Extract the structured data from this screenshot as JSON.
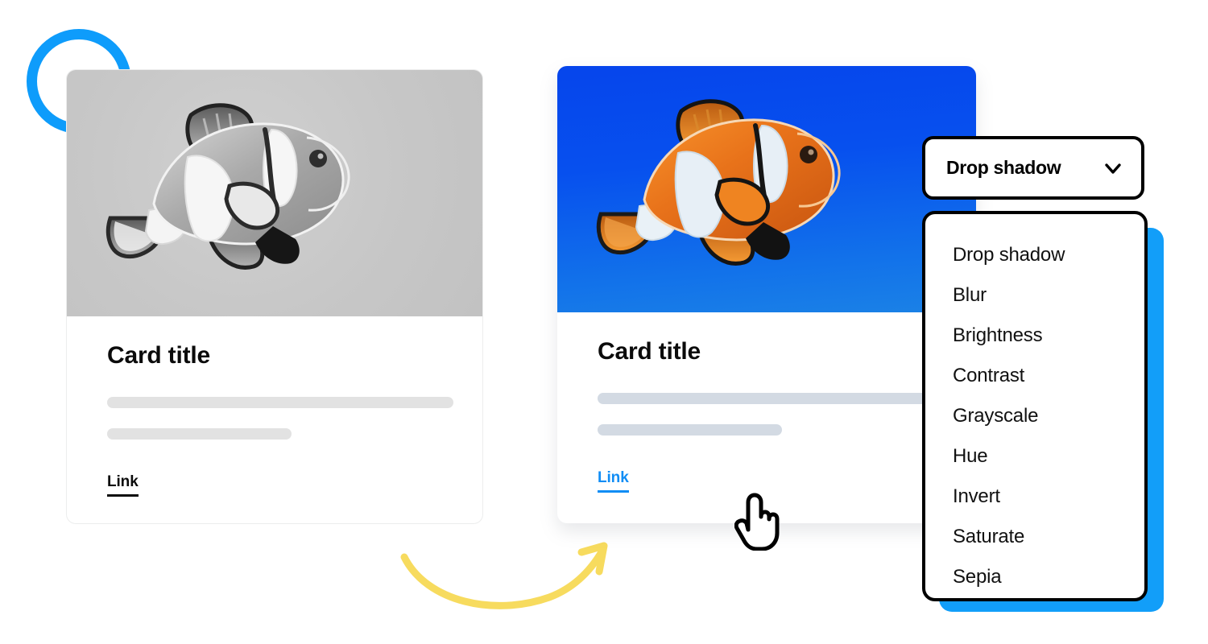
{
  "decor": {
    "ring": {
      "name": "blue-ring",
      "color": "#0e9cfb"
    },
    "arrow": {
      "name": "curved-arrow",
      "color": "#f7db5e"
    },
    "blue_plate_color": "#129ef9"
  },
  "cards": [
    {
      "id": "before",
      "state_label": "grayscale",
      "media": {
        "alt": "clownfish photo, grayscale filter applied",
        "background": "#c7c7c7",
        "mode": "grayscale"
      },
      "title": "Card title",
      "skeleton_lines": 2,
      "link_label": "Link",
      "link_color": "#0b0b0b"
    },
    {
      "id": "after",
      "state_label": "original",
      "media": {
        "alt": "clownfish photo, full color on blue water",
        "background": "#0645ec",
        "mode": "color"
      },
      "title": "Card title",
      "skeleton_lines": 2,
      "link_label": "Link",
      "link_color": "#108df5"
    }
  ],
  "filter_select": {
    "label": "Drop shadow",
    "selected": "Drop shadow",
    "chevron_icon": "chevron-down-icon",
    "options": [
      "Drop shadow",
      "Blur",
      "Brightness",
      "Contrast",
      "Grayscale",
      "Hue",
      "Invert",
      "Saturate",
      "Sepia"
    ]
  },
  "cursor": {
    "icon": "pointing-hand-cursor-icon"
  }
}
